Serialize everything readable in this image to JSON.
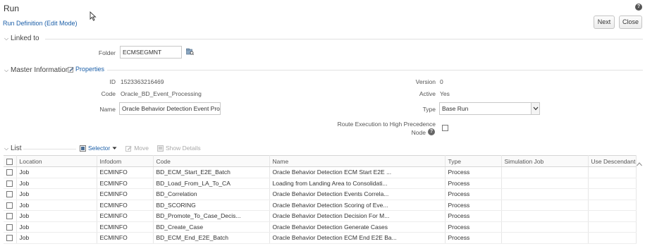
{
  "header": {
    "title": "Run",
    "breadcrumb": "Run Definition (Edit Mode)",
    "help": "?",
    "buttons": {
      "next": "Next",
      "close": "Close"
    }
  },
  "linked_to": {
    "title": "Linked to",
    "folder_label": "Folder",
    "folder_value": "ECMSEGMNT"
  },
  "master": {
    "title": "Master Information",
    "properties_link": "Properties",
    "id_label": "ID",
    "id_value": "1523363216469",
    "code_label": "Code",
    "code_value": "Oracle_BD_Event_Processing",
    "name_label": "Name",
    "name_value": "Oracle Behavior Detection Event Proce",
    "version_label": "Version",
    "version_value": "0",
    "active_label": "Active",
    "active_value": "Yes",
    "type_label": "Type",
    "type_value": "Base Run",
    "route_label_1": "Route Execution to High Precedence",
    "route_label_2": "Node",
    "help": "?"
  },
  "list": {
    "title": "List",
    "toolbar": {
      "selector": "Selector",
      "move": "Move",
      "show_details": "Show Details"
    },
    "columns": [
      "Location",
      "Infodom",
      "Code",
      "Name",
      "Type",
      "Simulation Job",
      "Use Descendants"
    ],
    "rows": [
      {
        "location": "Job",
        "infodom": "ECMINFO",
        "code": "BD_ECM_Start_E2E_Batch",
        "name": "Oracle Behavior Detection ECM Start E2E ...",
        "type": "Process",
        "sim": "",
        "desc": ""
      },
      {
        "location": "Job",
        "infodom": "ECMINFO",
        "code": "BD_Load_From_LA_To_CA",
        "name": "Loading from Landing Area to Consolidati...",
        "type": "Process",
        "sim": "",
        "desc": ""
      },
      {
        "location": "Job",
        "infodom": "ECMINFO",
        "code": "BD_Correlation",
        "name": "Oracle Behavior Detection Events Correla...",
        "type": "Process",
        "sim": "",
        "desc": ""
      },
      {
        "location": "Job",
        "infodom": "ECMINFO",
        "code": "BD_SCORING",
        "name": "Oracle Behavior Detection Scoring of Eve...",
        "type": "Process",
        "sim": "",
        "desc": ""
      },
      {
        "location": "Job",
        "infodom": "ECMINFO",
        "code": "BD_Promote_To_Case_Decis...",
        "name": "Oracle Behavior Detection Decision For M...",
        "type": "Process",
        "sim": "",
        "desc": ""
      },
      {
        "location": "Job",
        "infodom": "ECMINFO",
        "code": "BD_Create_Case",
        "name": "Oracle Behavior Detection Generate Cases",
        "type": "Process",
        "sim": "",
        "desc": ""
      },
      {
        "location": "Job",
        "infodom": "ECMINFO",
        "code": "BD_ECM_End_E2E_Batch",
        "name": "Oracle Behavior Detection ECM End E2E Ba...",
        "type": "Process",
        "sim": "",
        "desc": ""
      }
    ]
  }
}
